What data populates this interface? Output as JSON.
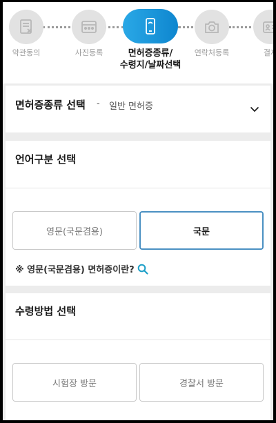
{
  "stepper": {
    "steps": [
      {
        "label": "약관동의",
        "icon": "document-icon"
      },
      {
        "label": "사진등록",
        "icon": "photo-grid-icon"
      },
      {
        "label_line1": "면허증종류/",
        "label_line2": "수령지/날짜선택",
        "icon": "phone-icon"
      },
      {
        "label": "연락처등록",
        "icon": "camera-icon"
      },
      {
        "label": "결제",
        "icon": "id-card-icon"
      }
    ],
    "active_index": 2,
    "active_color": "#1a96db",
    "inactive_color": "#e2e2e2"
  },
  "license_type": {
    "title": "면허증종류 선택",
    "separator": "-",
    "selected_value": "일반 면허증"
  },
  "language": {
    "title": "언어구분 선택",
    "options": [
      "영문(국문겸용)",
      "국문"
    ],
    "selected": "국문",
    "note": "※ 영문(국문겸용) 면허증이란?"
  },
  "receive": {
    "title": "수령방법 선택",
    "options": [
      "시험장 방문",
      "경찰서 방문"
    ]
  },
  "colors": {
    "accent": "#4a90c2",
    "background": "#ececec"
  }
}
